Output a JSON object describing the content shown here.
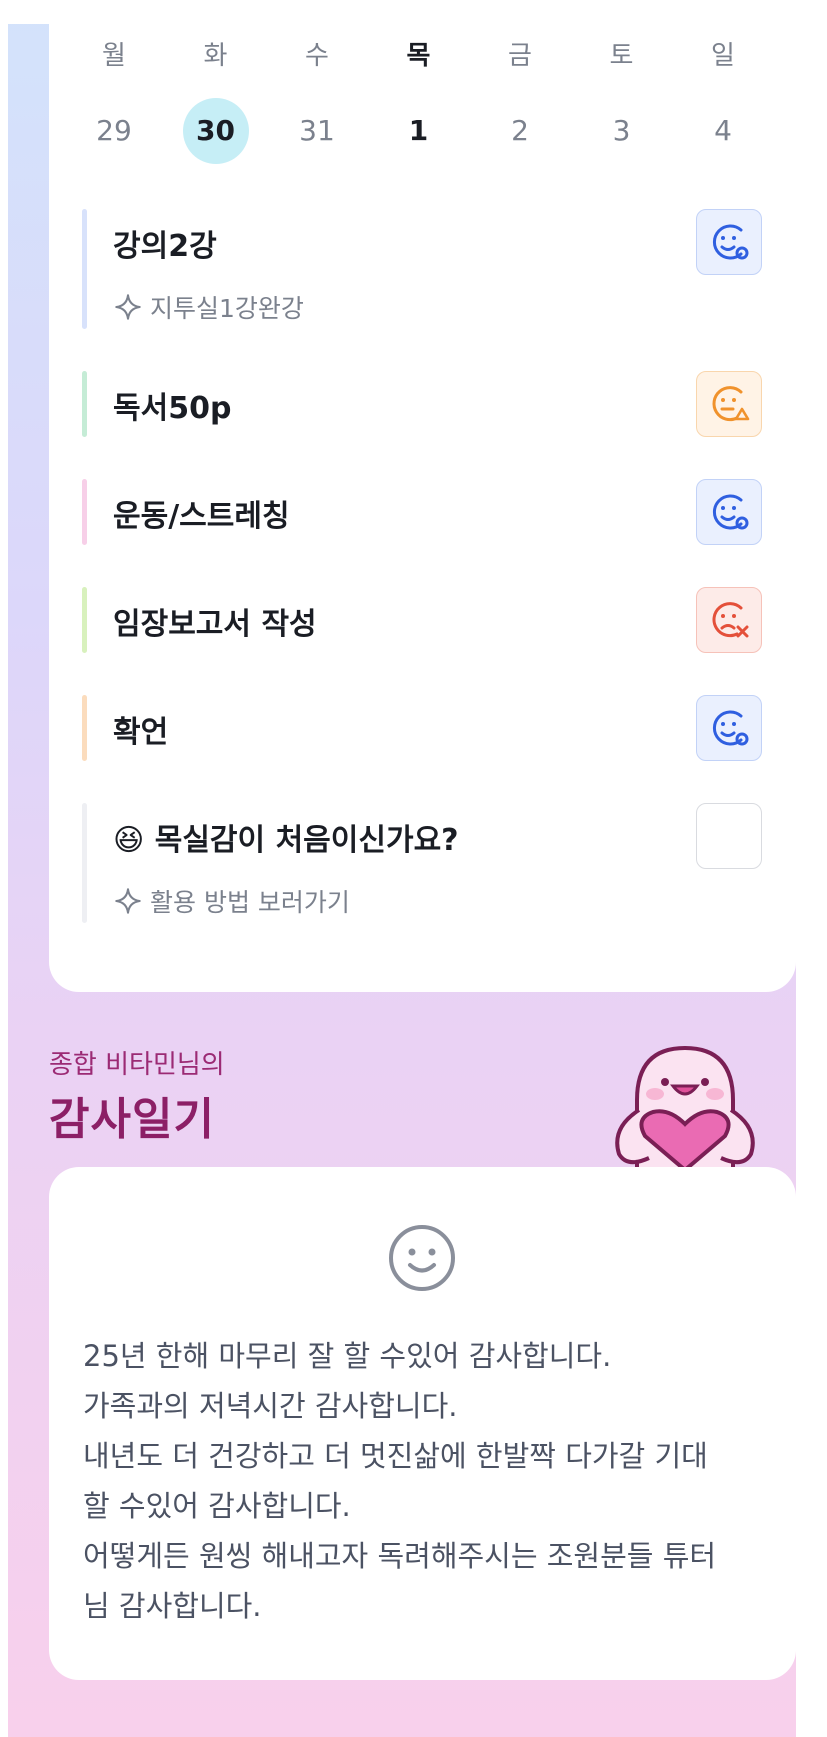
{
  "calendar": {
    "weekdays": [
      "월",
      "화",
      "수",
      "목",
      "금",
      "토",
      "일"
    ],
    "dates": [
      "29",
      "30",
      "31",
      "1",
      "2",
      "3",
      "4"
    ],
    "today_index": 1,
    "active_index": 3
  },
  "todos": [
    {
      "title": "강의2강",
      "sub": "지투실1강완강",
      "status": "done",
      "bar_color": "#d8e2fb"
    },
    {
      "title": "독서50p",
      "sub": "",
      "status": "partial",
      "bar_color": "#c5ecd6"
    },
    {
      "title": "운동/스트레칭",
      "sub": "",
      "status": "done",
      "bar_color": "#f7cfe8"
    },
    {
      "title": "임장보고서 작성",
      "sub": "",
      "status": "fail",
      "bar_color": "#d8f1bd"
    },
    {
      "title": "확언",
      "sub": "",
      "status": "done",
      "bar_color": "#fbdcbd"
    },
    {
      "title": "😆 목실감이 처음이신가요?",
      "sub": "활용 방법 보러가기",
      "status": "empty",
      "bar_color": "#eeeff3"
    }
  ],
  "gratitude": {
    "owner_label": "종합 비타민님의",
    "title": "감사일기",
    "lines": [
      "25년 한해 마무리 잘 할 수있어 감사합니다.",
      "가족과의 저녁시간 감사합니다.",
      "내년도 더 건강하고 더 멋진삶에 한발짝 다가갈 기대",
      "할 수있어 감사합니다.",
      "어떻게든 원씽 해내고자 독려해주시는 조원분들 튜터",
      "님 감사합니다."
    ]
  },
  "colors": {
    "done": "#2f5fe0",
    "partial": "#f0922c",
    "fail": "#e4503a",
    "accent_text": "#8c1f66"
  },
  "icons": {
    "sparkle": "sparkle-icon",
    "done": "smile-done-icon",
    "partial": "smile-partial-icon",
    "fail": "smile-fail-icon",
    "diary_face": "smile-face-icon"
  }
}
